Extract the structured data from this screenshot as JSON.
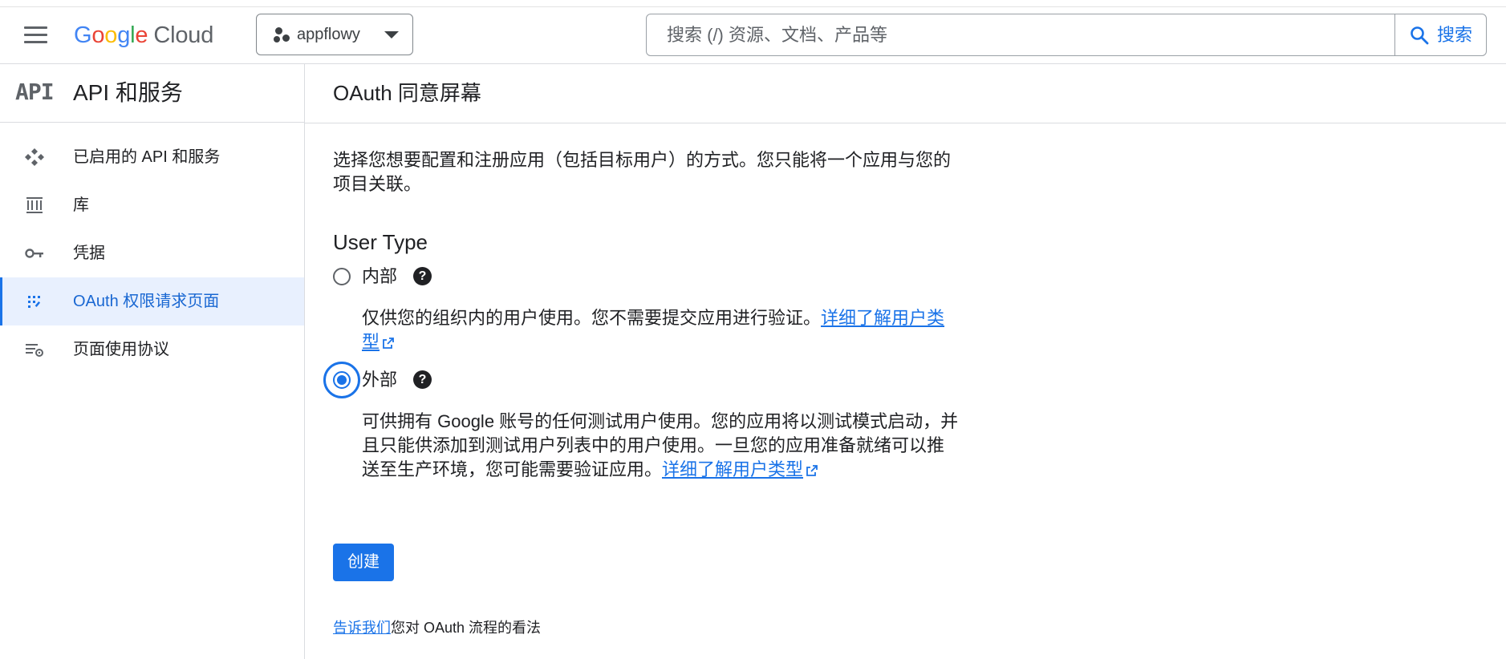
{
  "header": {
    "logo": {
      "g1": "G",
      "g2": "o",
      "g3": "o",
      "g4": "g",
      "g5": "l",
      "g6": "e",
      "cloud": "Cloud"
    },
    "project": {
      "name": "appflowy",
      "icon": "project-dots-icon"
    },
    "search": {
      "placeholder": "搜索 (/) 资源、文档、产品等",
      "value": "",
      "button_label": "搜索"
    }
  },
  "sidebar": {
    "logo_text": "API",
    "title": "API 和服务",
    "items": [
      {
        "label": "已启用的 API 和服务",
        "icon": "api-diamond-icon",
        "active": false
      },
      {
        "label": "库",
        "icon": "library-icon",
        "active": false
      },
      {
        "label": "凭据",
        "icon": "key-icon",
        "active": false
      },
      {
        "label": "OAuth 权限请求页面",
        "icon": "oauth-consent-icon",
        "active": true
      },
      {
        "label": "页面使用协议",
        "icon": "settings-list-icon",
        "active": false
      }
    ]
  },
  "main": {
    "title": "OAuth 同意屏幕",
    "intro": "选择您想要配置和注册应用（包括目标用户）的方式。您只能将一个应用与您的项目关联。",
    "user_type_title": "User Type",
    "options": [
      {
        "label": "内部",
        "checked": false,
        "desc_text": "仅供您的组织内的用户使用。您不需要提交应用进行验证。",
        "link": "详细了解用户类型"
      },
      {
        "label": "外部",
        "checked": true,
        "desc_text": "可供拥有 Google 账号的任何测试用户使用。您的应用将以测试模式启动，并且只能供添加到测试用户列表中的用户使用。一旦您的应用准备就绪可以推送至生产环境，您可能需要验证应用。",
        "link": "详细了解用户类型"
      }
    ],
    "create_button": "创建",
    "feedback_link": "告诉我们",
    "feedback_text": "您对 OAuth 流程的看法"
  },
  "colors": {
    "accent": "#1a73e8",
    "active_bg": "#e8f0fe",
    "icon_gray": "#5f6368"
  }
}
